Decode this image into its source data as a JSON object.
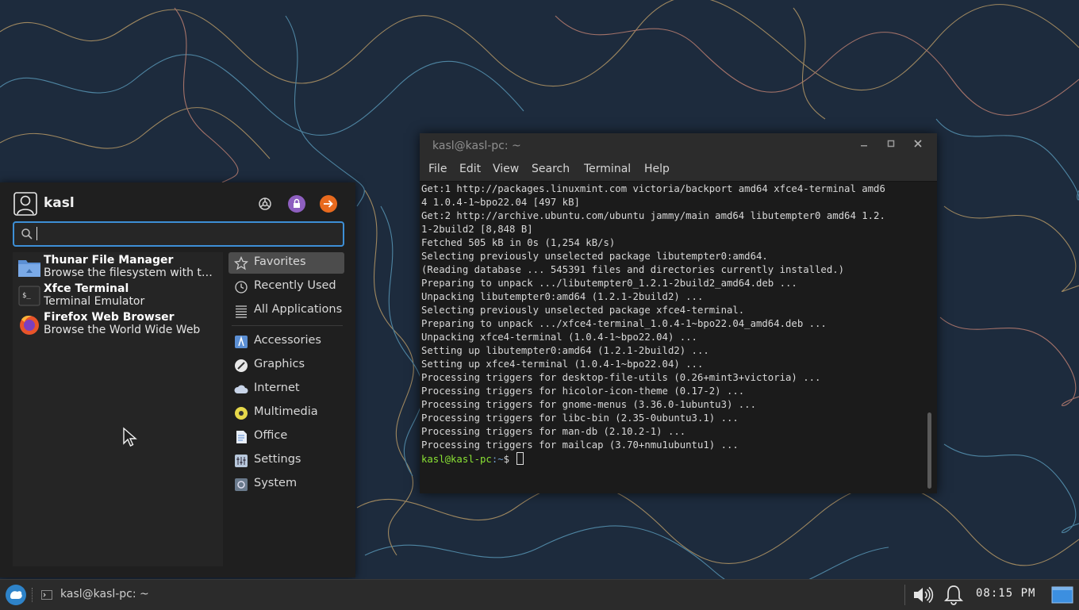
{
  "terminal": {
    "title": "kasl@kasl-pc: ~",
    "menu": [
      "File",
      "Edit",
      "View",
      "Search",
      "Terminal",
      "Help"
    ],
    "lines": [
      "Get:1 http://packages.linuxmint.com victoria/backport amd64 xfce4-terminal amd6",
      "4 1.0.4-1~bpo22.04 [497 kB]",
      "Get:2 http://archive.ubuntu.com/ubuntu jammy/main amd64 libutempter0 amd64 1.2.",
      "1-2build2 [8,848 B]",
      "Fetched 505 kB in 0s (1,254 kB/s)",
      "Selecting previously unselected package libutempter0:amd64.",
      "(Reading database ... 545391 files and directories currently installed.)",
      "Preparing to unpack .../libutempter0_1.2.1-2build2_amd64.deb ...",
      "Unpacking libutempter0:amd64 (1.2.1-2build2) ...",
      "Selecting previously unselected package xfce4-terminal.",
      "Preparing to unpack .../xfce4-terminal_1.0.4-1~bpo22.04_amd64.deb ...",
      "Unpacking xfce4-terminal (1.0.4-1~bpo22.04) ...",
      "Setting up libutempter0:amd64 (1.2.1-2build2) ...",
      "Setting up xfce4-terminal (1.0.4-1~bpo22.04) ...",
      "Processing triggers for desktop-file-utils (0.26+mint3+victoria) ...",
      "Processing triggers for hicolor-icon-theme (0.17-2) ...",
      "Processing triggers for gnome-menus (3.36.0-1ubuntu3) ...",
      "Processing triggers for libc-bin (2.35-0ubuntu3.1) ...",
      "Processing triggers for man-db (2.10.2-1) ...",
      "Processing triggers for mailcap (3.70+nmu1ubuntu1) ..."
    ],
    "prompt_user": "kasl@kasl-pc",
    "prompt_path": ":~",
    "prompt_symbol": "$"
  },
  "whisker": {
    "username": "kasl",
    "search_value": "",
    "header_buttons": [
      "settings-icon",
      "lock-icon",
      "logout-icon"
    ],
    "apps": [
      {
        "name": "Thunar File Manager",
        "desc": "Browse the filesystem with the file manager",
        "icon": "folder-icon"
      },
      {
        "name": "Xfce Terminal",
        "desc": "Terminal Emulator",
        "icon": "terminal-icon"
      },
      {
        "name": "Firefox Web Browser",
        "desc": "Browse the World Wide Web",
        "icon": "firefox-icon"
      }
    ],
    "categories_top": [
      "Favorites",
      "Recently Used",
      "All Applications"
    ],
    "categories": [
      "Accessories",
      "Graphics",
      "Internet",
      "Multimedia",
      "Office",
      "Settings",
      "System"
    ],
    "selected_category": "Favorites"
  },
  "panel": {
    "task_label": "kasl@kasl-pc: ~",
    "clock": "08:15 PM"
  },
  "colors": {
    "accent": "#3d8fd6",
    "prompt_user": "#8ae234",
    "prompt_path": "#729fcf",
    "wallpaper": "#1c2a3c"
  }
}
